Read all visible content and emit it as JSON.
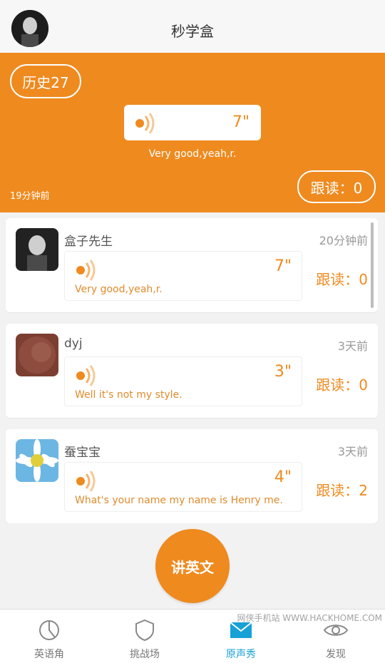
{
  "header": {
    "title": "秒学盒"
  },
  "banner": {
    "history_label": "历史27",
    "duration": "7\"",
    "sentence": "Very good,yeah,r.",
    "time": "19分钟前",
    "follow_label": "跟读：0"
  },
  "feed": {
    "items": [
      {
        "name": "盒子先生",
        "time": "20分钟前",
        "duration": "7\"",
        "sentence": "Very good,yeah,r.",
        "follow": "跟读：0"
      },
      {
        "name": "dyj",
        "time": "3天前",
        "duration": "3\"",
        "sentence": "Well it's not my style.",
        "follow": "跟读：0"
      },
      {
        "name": "蚕宝宝",
        "time": "3天前",
        "duration": "4\"",
        "sentence": "What's your name my name is Henry me.",
        "follow": "跟读：2"
      }
    ]
  },
  "speak_button": {
    "label": "讲英文"
  },
  "nav": {
    "items": [
      {
        "label": "英语角",
        "icon": "chart-pie-icon"
      },
      {
        "label": "挑战场",
        "icon": "shield-icon"
      },
      {
        "label": "原声秀",
        "icon": "mail-icon"
      },
      {
        "label": "发现",
        "icon": "eye-icon"
      }
    ]
  },
  "colors": {
    "accent": "#ef8a1f",
    "nav_active": "#17a1d7"
  },
  "watermark": "网侠手机站 WWW.HACKHOME.COM"
}
